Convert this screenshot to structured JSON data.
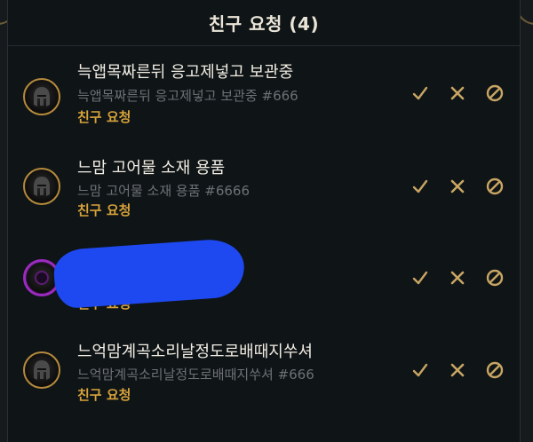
{
  "header": {
    "title": "친구 요청 (4)"
  },
  "requests": [
    {
      "name": "늑앱목짜른뒤 응고제넣고 보관중",
      "tag": "늑앱목짜른뒤 응고제넣고 보관중 #666",
      "status": "친구 요청"
    },
    {
      "name": "느맘 고어물 소재 용품",
      "tag": "느맘 고어물 소재 용품 #6666",
      "status": "친구 요청"
    },
    {
      "name": "",
      "tag": "",
      "status": "친구 요청"
    },
    {
      "name": "느억맘계곡소리날정도로배때지쑤셔",
      "tag": "느억맘계곡소리날정도로배때지쑤셔 #666",
      "status": "친구 요청"
    }
  ],
  "actions": {
    "accept_icon": "check-icon",
    "decline_icon": "x-icon",
    "block_icon": "block-icon"
  },
  "colors": {
    "background": "#0f1417",
    "gold": "#b58a3c",
    "status_text": "#d6a23a",
    "name_text": "#f1ede3",
    "tag_text": "#6c7175",
    "redaction": "#1e49f0",
    "purple_ring": "#9b2bbf"
  }
}
